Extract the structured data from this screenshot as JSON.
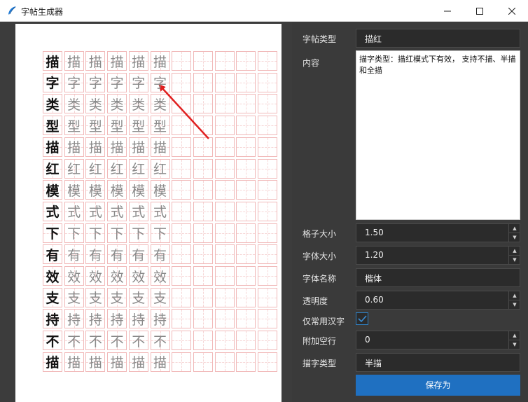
{
  "window": {
    "title": "字帖生成器",
    "icon": "feather-icon",
    "accent_color": "#1f70c1"
  },
  "preview": {
    "lead_chars": [
      "描",
      "字",
      "类",
      "型",
      "描",
      "红",
      "模",
      "式",
      "下",
      "有",
      "效",
      "支",
      "持",
      "不",
      "描"
    ],
    "trace_copies": 5,
    "blank_cells": 5,
    "grid_line_color": "#f1b9b9"
  },
  "panel": {
    "type_label": "字帖类型",
    "type_value": "描红",
    "content_label": "内容",
    "content_value": "描字类型：描红模式下有效，  支持不描、半描和全描",
    "cell_size_label": "格子大小",
    "cell_size_value": "1.50",
    "font_size_label": "字体大小",
    "font_size_value": "1.20",
    "font_name_label": "字体名称",
    "font_name_value": "楷体",
    "opacity_label": "透明度",
    "opacity_value": "0.60",
    "common_only_label": "仅常用汉字",
    "common_only_checked": true,
    "extra_blank_label": "附加空行",
    "extra_blank_value": "0",
    "trace_type_label": "描字类型",
    "trace_type_value": "半描",
    "save_label": "保存为"
  }
}
